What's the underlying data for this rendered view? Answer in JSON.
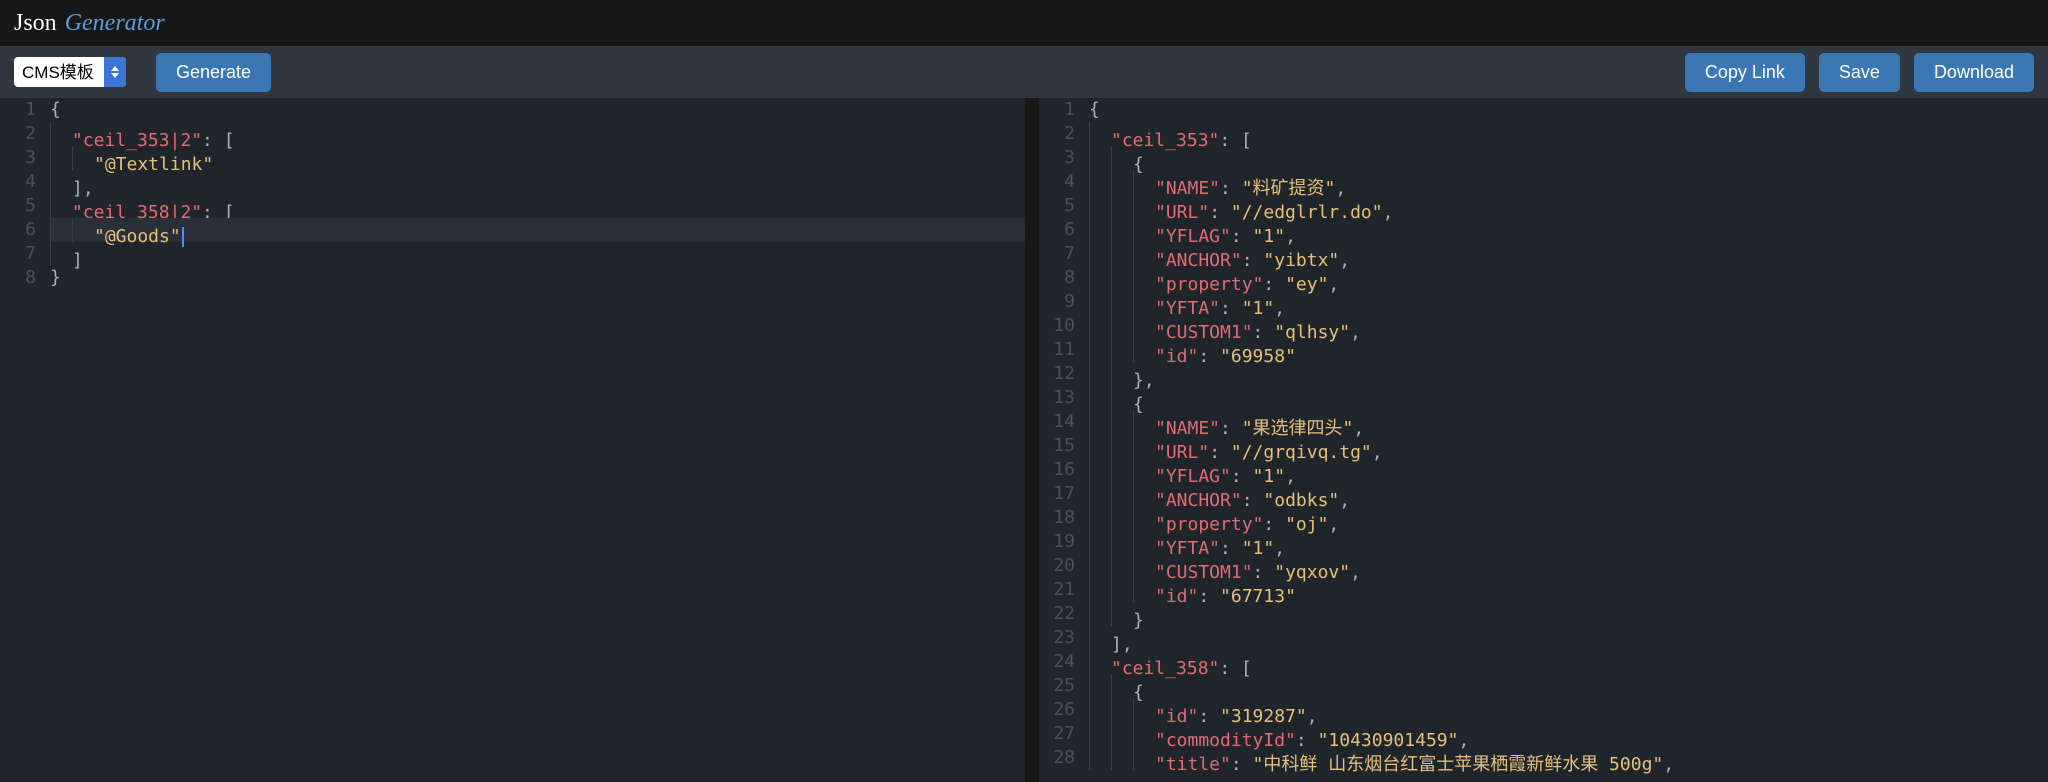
{
  "logo": {
    "left": "Json",
    "right": "Generator"
  },
  "toolbar": {
    "template_option": "CMS模板",
    "generate": "Generate",
    "copy_link": "Copy Link",
    "save": "Save",
    "download": "Download"
  },
  "left_editor": {
    "lines": [
      [
        {
          "t": "brace",
          "v": "{"
        }
      ],
      [
        {
          "t": "indent",
          "v": "  "
        },
        {
          "t": "key",
          "v": "\"ceil_353|2\""
        },
        {
          "t": "punc",
          "v": ": ["
        }
      ],
      [
        {
          "t": "indent",
          "v": "    "
        },
        {
          "t": "str",
          "v": "\"@Textlink\""
        }
      ],
      [
        {
          "t": "indent",
          "v": "  "
        },
        {
          "t": "punc",
          "v": "],"
        }
      ],
      [
        {
          "t": "indent",
          "v": "  "
        },
        {
          "t": "key",
          "v": "\"ceil_358|2\""
        },
        {
          "t": "punc",
          "v": ": ["
        }
      ],
      [
        {
          "t": "indent",
          "v": "    "
        },
        {
          "t": "str",
          "v": "\"@Goods\""
        },
        {
          "t": "cursor",
          "v": ""
        }
      ],
      [
        {
          "t": "indent",
          "v": "  "
        },
        {
          "t": "punc",
          "v": "]"
        }
      ],
      [
        {
          "t": "brace",
          "v": "}"
        }
      ]
    ],
    "highlight_line": 6
  },
  "right_editor": {
    "lines": [
      [
        {
          "t": "brace",
          "v": "{"
        }
      ],
      [
        {
          "t": "indent",
          "v": "  "
        },
        {
          "t": "key",
          "v": "\"ceil_353\""
        },
        {
          "t": "punc",
          "v": ": ["
        }
      ],
      [
        {
          "t": "indent",
          "v": "    "
        },
        {
          "t": "brace",
          "v": "{"
        }
      ],
      [
        {
          "t": "indent",
          "v": "      "
        },
        {
          "t": "key",
          "v": "\"NAME\""
        },
        {
          "t": "punc",
          "v": ": "
        },
        {
          "t": "str",
          "v": "\"料矿提资\""
        },
        {
          "t": "punc",
          "v": ","
        }
      ],
      [
        {
          "t": "indent",
          "v": "      "
        },
        {
          "t": "key",
          "v": "\"URL\""
        },
        {
          "t": "punc",
          "v": ": "
        },
        {
          "t": "str",
          "v": "\"//edglrlr.do\""
        },
        {
          "t": "punc",
          "v": ","
        }
      ],
      [
        {
          "t": "indent",
          "v": "      "
        },
        {
          "t": "key",
          "v": "\"YFLAG\""
        },
        {
          "t": "punc",
          "v": ": "
        },
        {
          "t": "str",
          "v": "\"1\""
        },
        {
          "t": "punc",
          "v": ","
        }
      ],
      [
        {
          "t": "indent",
          "v": "      "
        },
        {
          "t": "key",
          "v": "\"ANCHOR\""
        },
        {
          "t": "punc",
          "v": ": "
        },
        {
          "t": "str",
          "v": "\"yibtx\""
        },
        {
          "t": "punc",
          "v": ","
        }
      ],
      [
        {
          "t": "indent",
          "v": "      "
        },
        {
          "t": "key",
          "v": "\"property\""
        },
        {
          "t": "punc",
          "v": ": "
        },
        {
          "t": "str",
          "v": "\"ey\""
        },
        {
          "t": "punc",
          "v": ","
        }
      ],
      [
        {
          "t": "indent",
          "v": "      "
        },
        {
          "t": "key",
          "v": "\"YFTA\""
        },
        {
          "t": "punc",
          "v": ": "
        },
        {
          "t": "str",
          "v": "\"1\""
        },
        {
          "t": "punc",
          "v": ","
        }
      ],
      [
        {
          "t": "indent",
          "v": "      "
        },
        {
          "t": "key",
          "v": "\"CUSTOM1\""
        },
        {
          "t": "punc",
          "v": ": "
        },
        {
          "t": "str",
          "v": "\"qlhsy\""
        },
        {
          "t": "punc",
          "v": ","
        }
      ],
      [
        {
          "t": "indent",
          "v": "      "
        },
        {
          "t": "key",
          "v": "\"id\""
        },
        {
          "t": "punc",
          "v": ": "
        },
        {
          "t": "str",
          "v": "\"69958\""
        }
      ],
      [
        {
          "t": "indent",
          "v": "    "
        },
        {
          "t": "brace",
          "v": "}"
        },
        {
          "t": "punc",
          "v": ","
        }
      ],
      [
        {
          "t": "indent",
          "v": "    "
        },
        {
          "t": "brace",
          "v": "{"
        }
      ],
      [
        {
          "t": "indent",
          "v": "      "
        },
        {
          "t": "key",
          "v": "\"NAME\""
        },
        {
          "t": "punc",
          "v": ": "
        },
        {
          "t": "str",
          "v": "\"果选律四头\""
        },
        {
          "t": "punc",
          "v": ","
        }
      ],
      [
        {
          "t": "indent",
          "v": "      "
        },
        {
          "t": "key",
          "v": "\"URL\""
        },
        {
          "t": "punc",
          "v": ": "
        },
        {
          "t": "str",
          "v": "\"//grqivq.tg\""
        },
        {
          "t": "punc",
          "v": ","
        }
      ],
      [
        {
          "t": "indent",
          "v": "      "
        },
        {
          "t": "key",
          "v": "\"YFLAG\""
        },
        {
          "t": "punc",
          "v": ": "
        },
        {
          "t": "str",
          "v": "\"1\""
        },
        {
          "t": "punc",
          "v": ","
        }
      ],
      [
        {
          "t": "indent",
          "v": "      "
        },
        {
          "t": "key",
          "v": "\"ANCHOR\""
        },
        {
          "t": "punc",
          "v": ": "
        },
        {
          "t": "str",
          "v": "\"odbks\""
        },
        {
          "t": "punc",
          "v": ","
        }
      ],
      [
        {
          "t": "indent",
          "v": "      "
        },
        {
          "t": "key",
          "v": "\"property\""
        },
        {
          "t": "punc",
          "v": ": "
        },
        {
          "t": "str",
          "v": "\"oj\""
        },
        {
          "t": "punc",
          "v": ","
        }
      ],
      [
        {
          "t": "indent",
          "v": "      "
        },
        {
          "t": "key",
          "v": "\"YFTA\""
        },
        {
          "t": "punc",
          "v": ": "
        },
        {
          "t": "str",
          "v": "\"1\""
        },
        {
          "t": "punc",
          "v": ","
        }
      ],
      [
        {
          "t": "indent",
          "v": "      "
        },
        {
          "t": "key",
          "v": "\"CUSTOM1\""
        },
        {
          "t": "punc",
          "v": ": "
        },
        {
          "t": "str",
          "v": "\"yqxov\""
        },
        {
          "t": "punc",
          "v": ","
        }
      ],
      [
        {
          "t": "indent",
          "v": "      "
        },
        {
          "t": "key",
          "v": "\"id\""
        },
        {
          "t": "punc",
          "v": ": "
        },
        {
          "t": "str",
          "v": "\"67713\""
        }
      ],
      [
        {
          "t": "indent",
          "v": "    "
        },
        {
          "t": "brace",
          "v": "}"
        }
      ],
      [
        {
          "t": "indent",
          "v": "  "
        },
        {
          "t": "punc",
          "v": "],"
        }
      ],
      [
        {
          "t": "indent",
          "v": "  "
        },
        {
          "t": "key",
          "v": "\"ceil_358\""
        },
        {
          "t": "punc",
          "v": ": ["
        }
      ],
      [
        {
          "t": "indent",
          "v": "    "
        },
        {
          "t": "brace",
          "v": "{"
        }
      ],
      [
        {
          "t": "indent",
          "v": "      "
        },
        {
          "t": "key",
          "v": "\"id\""
        },
        {
          "t": "punc",
          "v": ": "
        },
        {
          "t": "str",
          "v": "\"319287\""
        },
        {
          "t": "punc",
          "v": ","
        }
      ],
      [
        {
          "t": "indent",
          "v": "      "
        },
        {
          "t": "key",
          "v": "\"commodityId\""
        },
        {
          "t": "punc",
          "v": ": "
        },
        {
          "t": "str",
          "v": "\"10430901459\""
        },
        {
          "t": "punc",
          "v": ","
        }
      ],
      [
        {
          "t": "indent",
          "v": "      "
        },
        {
          "t": "key",
          "v": "\"title\""
        },
        {
          "t": "punc",
          "v": ": "
        },
        {
          "t": "str",
          "v": "\"中科鲜 山东烟台红富士苹果栖霞新鲜水果 500g\""
        },
        {
          "t": "punc",
          "v": ","
        }
      ]
    ]
  }
}
